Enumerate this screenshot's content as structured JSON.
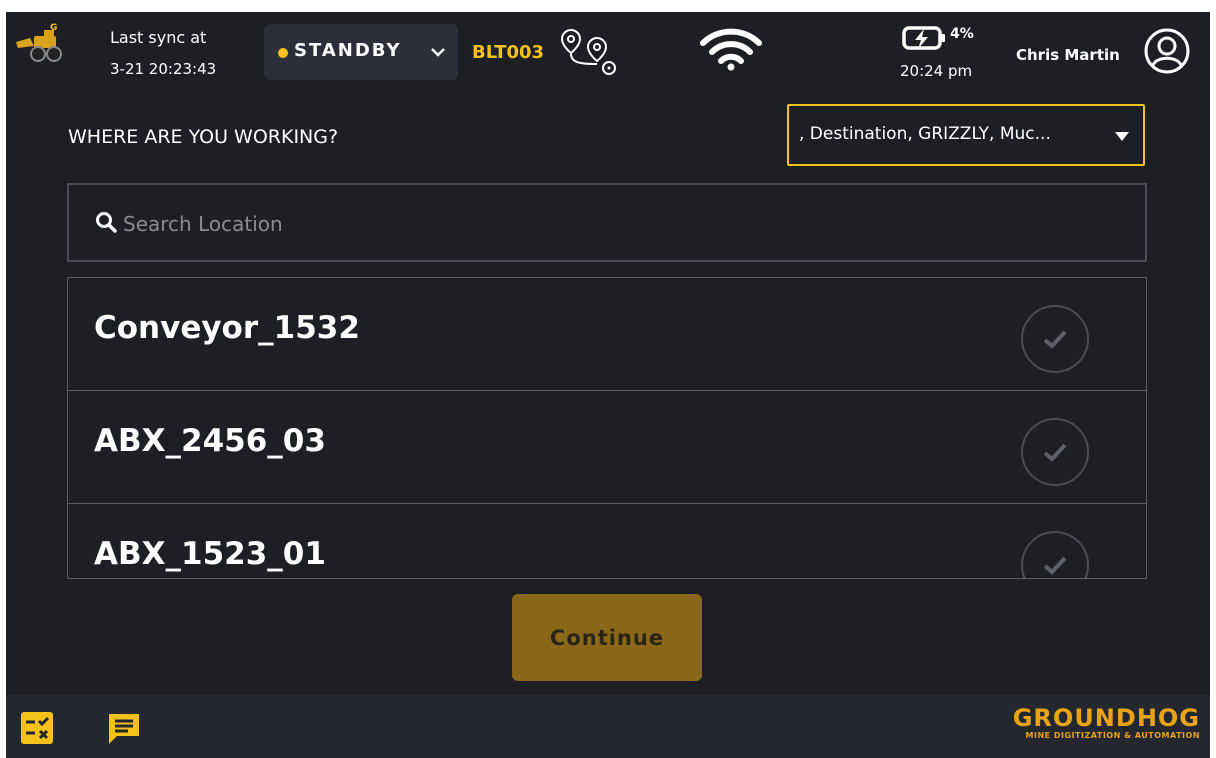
{
  "header": {
    "sync_label": "Last sync at",
    "sync_time": "3-21 20:23:43",
    "status": "STANDBY",
    "machine_id": "BLT003",
    "battery_percent": "4%",
    "clock": "20:24 pm",
    "user_name": "Chris Martin"
  },
  "main": {
    "question": "WHERE ARE YOU WORKING?",
    "filter_value": ", Destination, GRIZZLY, Muc...",
    "search_placeholder": "Search Location",
    "locations": [
      {
        "label": "Conveyor_1532"
      },
      {
        "label": "ABX_2456_03"
      },
      {
        "label": "ABX_1523_01"
      }
    ],
    "continue_label": "Continue"
  },
  "footer": {
    "brand_name": "GROUNDHOG",
    "brand_tagline": "MINE DIGITIZATION & AUTOMATION"
  },
  "colors": {
    "background": "#1e1f24",
    "accent": "#f5c21b",
    "button": "#8a6719",
    "brand": "#e8a317"
  }
}
